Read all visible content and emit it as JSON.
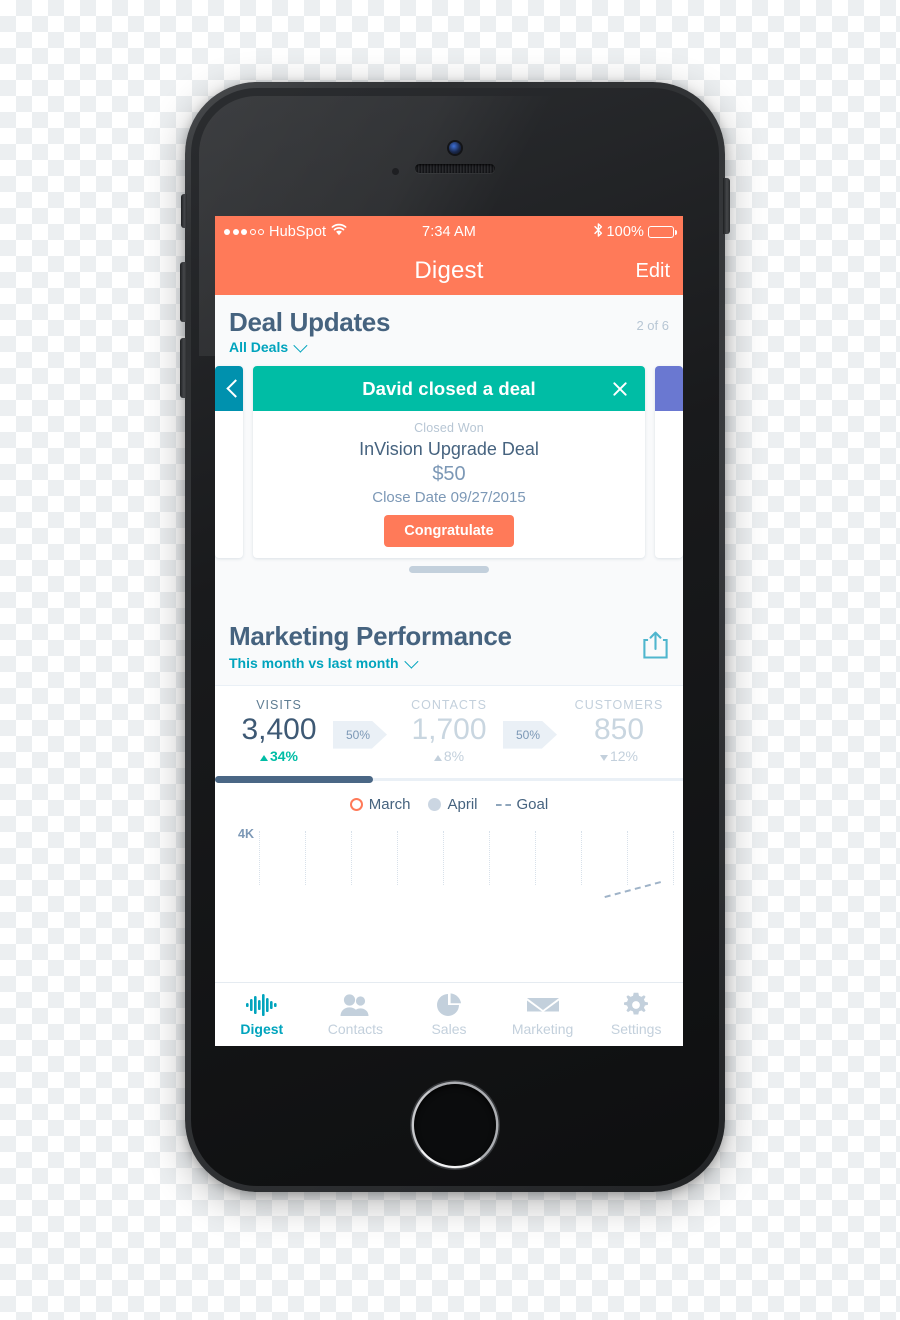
{
  "statusbar": {
    "carrier": "HubSpot",
    "time": "7:34 AM",
    "battery_pct": "100%",
    "signal_dots_filled": 3,
    "signal_dots_total": 5,
    "wifi_icon": "wifi-icon",
    "bluetooth_icon": "bluetooth-icon"
  },
  "navbar": {
    "title": "Digest",
    "edit_label": "Edit",
    "background": "#FF7A59"
  },
  "deal_updates": {
    "title": "Deal Updates",
    "counter": "2 of 6",
    "filter_label": "All Deals",
    "filter_chevron": "chevron-down-icon",
    "cards": {
      "left": {
        "header_color": "#0091AE",
        "icon": "chevron-left-icon"
      },
      "right": {
        "header_color": "#6A78D1"
      },
      "main": {
        "header_color": "#00BDA5",
        "title": "David closed a deal",
        "close_icon": "close-icon",
        "stage": "Closed Won",
        "deal_name": "InVision Upgrade Deal",
        "amount": "$50",
        "close_date": "Close Date 09/27/2015",
        "action_label": "Congratulate",
        "action_color": "#FF7A59"
      }
    }
  },
  "marketing_performance": {
    "title": "Marketing Performance",
    "subtitle": "This month vs last month",
    "subtitle_chevron": "chevron-down-icon",
    "share_icon": "share-icon",
    "metrics": [
      {
        "label": "VISITS",
        "value": "3,400",
        "delta": "34%",
        "direction": "up",
        "active": true
      },
      {
        "label": "CONTACTS",
        "value": "1,700",
        "delta": "8%",
        "direction": "up",
        "active": false
      },
      {
        "label": "CUSTOMERS",
        "value": "850",
        "delta": "12%",
        "direction": "down",
        "active": false
      }
    ],
    "conversions": [
      "50%",
      "50%"
    ],
    "scroll_progress_pct": 34
  },
  "chart_data": {
    "type": "line",
    "title": "Marketing Performance",
    "subtitle": "This month vs last month",
    "ylabel": "",
    "xlabel": "",
    "ytick_labels": [
      "4K"
    ],
    "ylim": [
      0,
      4000
    ],
    "grid": true,
    "legend_position": "top-right",
    "series": [
      {
        "name": "March",
        "marker": "ring",
        "color": "#FF7A59",
        "values": []
      },
      {
        "name": "April",
        "marker": "filled",
        "color": "#CBD6E2",
        "values": []
      },
      {
        "name": "Goal",
        "marker": "dashed",
        "color": "#9FB3C8",
        "values": []
      }
    ],
    "legend": [
      "March",
      "April",
      "Goal"
    ],
    "note": "Chart is clipped by the device viewport; only the 4K gridline label, dotted vertical gridlines and the rising dashed Goal segment at the right are visible."
  },
  "tabbar": {
    "items": [
      {
        "label": "Digest",
        "icon": "digest-waveform-icon",
        "active": true
      },
      {
        "label": "Contacts",
        "icon": "contacts-people-icon",
        "active": false
      },
      {
        "label": "Sales",
        "icon": "sales-piechart-icon",
        "active": false
      },
      {
        "label": "Marketing",
        "icon": "marketing-envelope-icon",
        "active": false
      },
      {
        "label": "Settings",
        "icon": "settings-gear-icon",
        "active": false
      }
    ]
  },
  "device": {
    "camera_icon": "front-camera",
    "speaker_icon": "earpiece-speaker",
    "home_button_icon": "home-button"
  }
}
